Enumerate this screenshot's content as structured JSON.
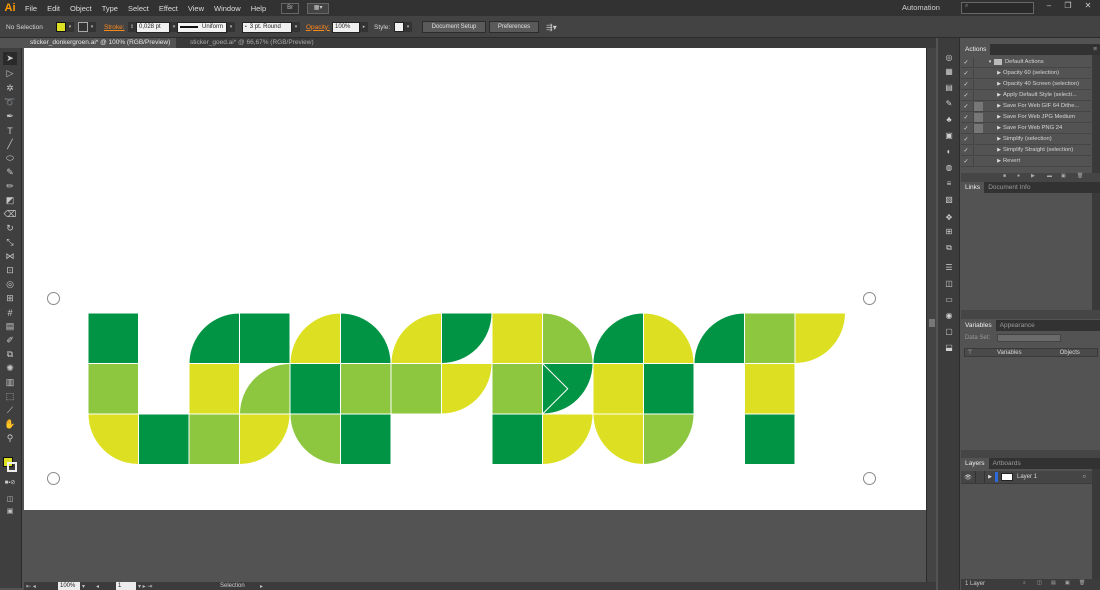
{
  "app": {
    "logo": "Ai",
    "workspace": "Automation",
    "search_placeholder": ""
  },
  "menu": [
    "File",
    "Edit",
    "Object",
    "Type",
    "Select",
    "Effect",
    "View",
    "Window",
    "Help"
  ],
  "bridge": {
    "label": "Br"
  },
  "window_controls": {
    "minimize": "–",
    "maximize": "❐",
    "close": "✕"
  },
  "control_bar": {
    "selection_label": "No Selection",
    "stroke_label": "Stroke:",
    "stroke_value": "0,028 pt",
    "profile_label": "Uniform",
    "brush_label": "3 pt. Round",
    "opacity_label": "Opacity:",
    "opacity_value": "100%",
    "style_label": "Style:",
    "document_setup": "Document Setup",
    "preferences": "Preferences",
    "fill_color": "#dde022"
  },
  "document_tabs": [
    {
      "label": "sticker_donkergroen.ai* @ 100% (RGB/Preview)",
      "active": true
    },
    {
      "label": "sticker_goed.ai* @ 66,67% (RGB/Preview)",
      "active": false
    }
  ],
  "status_bar": {
    "zoom": "100%",
    "artboard": "1",
    "tool": "Selection"
  },
  "artwork": {
    "colors": {
      "dark": "#009444",
      "light": "#8dc63f",
      "yellow": "#dde022"
    }
  },
  "panels": {
    "actions": {
      "tab": "Actions",
      "set": "Default Actions",
      "items": [
        "Opacity 60 (selection)",
        "Opacity 40 Screen (selection)",
        "Apply Default Style (selecti...",
        "Save For Web GIF 64 Dithe...",
        "Save For Web JPG Medium",
        "Save For Web PNG 24",
        "Simplify (selection)",
        "Simplify Straight (selection)",
        "Revert"
      ]
    },
    "links": {
      "tabs": [
        "Links",
        "Document Info"
      ]
    },
    "variables": {
      "tabs": [
        "Variables",
        "Appearance"
      ],
      "data_set_label": "Data Set:",
      "col_variables": "Variables",
      "col_objects": "Objects"
    },
    "layers": {
      "tabs": [
        "Layers",
        "Artboards"
      ],
      "layer_name": "Layer 1",
      "footer": "1 Layer"
    }
  }
}
